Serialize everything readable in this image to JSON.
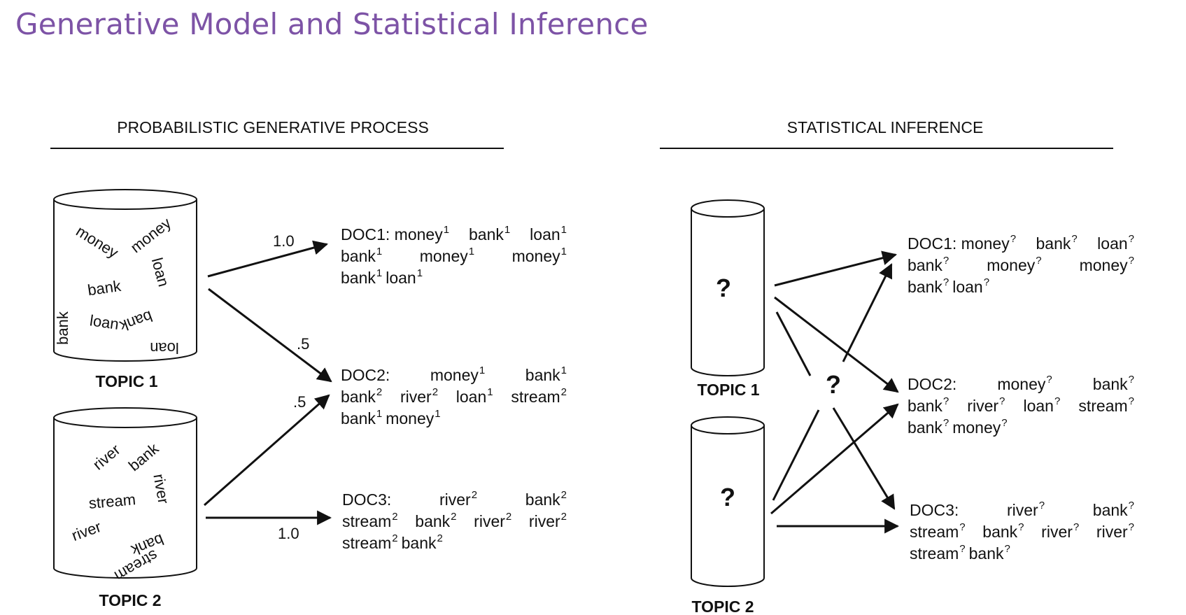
{
  "title": "Generative Model and Statistical Inference",
  "left_panel": {
    "header": "PROBABILISTIC GENERATIVE PROCESS",
    "topic1": {
      "label": "TOPIC 1",
      "words": [
        "money",
        "money",
        "loan",
        "bank",
        "bank",
        "loan",
        "bank",
        "loan"
      ]
    },
    "topic2": {
      "label": "TOPIC 2",
      "words": [
        "river",
        "bank",
        "river",
        "stream",
        "river",
        "bank",
        "stream"
      ]
    },
    "weights": {
      "topic1_doc1": "1.0",
      "topic1_doc2": ".5",
      "topic2_doc2": ".5",
      "topic2_doc3": "1.0"
    },
    "docs": {
      "doc1": {
        "line1": [
          [
            "DOC1: money",
            "1"
          ],
          [
            " bank",
            "1"
          ],
          [
            " loan",
            "1"
          ]
        ],
        "line2": [
          [
            "bank",
            "1"
          ],
          [
            "money",
            "1"
          ],
          [
            "money",
            "1"
          ]
        ],
        "line3": [
          [
            "bank",
            "1"
          ],
          [
            " loan",
            "1"
          ]
        ]
      },
      "doc2": {
        "line1": [
          [
            "DOC2:",
            ""
          ],
          [
            "money",
            "1"
          ],
          [
            "bank",
            "1"
          ]
        ],
        "line2": [
          [
            "bank",
            "2"
          ],
          [
            "river",
            "2"
          ],
          [
            "loan",
            "1"
          ],
          [
            "stream",
            "2"
          ]
        ],
        "line3": [
          [
            "bank",
            "1"
          ],
          [
            " money",
            "1"
          ]
        ]
      },
      "doc3": {
        "line1": [
          [
            "DOC3:",
            ""
          ],
          [
            "river",
            "2"
          ],
          [
            "bank",
            "2"
          ]
        ],
        "line2": [
          [
            "stream",
            "2"
          ],
          [
            "bank",
            "2"
          ],
          [
            "river",
            "2"
          ],
          [
            "river",
            "2"
          ]
        ],
        "line3": [
          [
            "stream",
            "2"
          ],
          [
            " bank",
            "2"
          ]
        ]
      }
    }
  },
  "right_panel": {
    "header": "STATISTICAL INFERENCE",
    "topic1": {
      "label": "TOPIC 1",
      "mark": "?"
    },
    "topic2": {
      "label": "TOPIC 2",
      "mark": "?"
    },
    "center_mark": "?",
    "docs": {
      "doc1": {
        "line1": [
          [
            "DOC1: money",
            "?"
          ],
          [
            " bank",
            "?"
          ],
          [
            " loan",
            "?"
          ]
        ],
        "line2": [
          [
            "bank",
            "?"
          ],
          [
            "money",
            "?"
          ],
          [
            "money",
            "?"
          ]
        ],
        "line3": [
          [
            "bank",
            "?"
          ],
          [
            " loan",
            "?"
          ]
        ]
      },
      "doc2": {
        "line1": [
          [
            "DOC2:",
            ""
          ],
          [
            "money",
            "?"
          ],
          [
            "bank",
            "?"
          ]
        ],
        "line2": [
          [
            "bank",
            "?"
          ],
          [
            "river",
            "?"
          ],
          [
            "loan",
            "?"
          ],
          [
            "stream",
            "?"
          ]
        ],
        "line3": [
          [
            "bank",
            "?"
          ],
          [
            " money",
            "?"
          ]
        ]
      },
      "doc3": {
        "line1": [
          [
            "DOC3:",
            ""
          ],
          [
            "river",
            "?"
          ],
          [
            "bank",
            "?"
          ]
        ],
        "line2": [
          [
            "stream",
            "?"
          ],
          [
            "bank",
            "?"
          ],
          [
            "river",
            "?"
          ],
          [
            "river",
            "?"
          ]
        ],
        "line3": [
          [
            "stream",
            "?"
          ],
          [
            " bank",
            "?"
          ]
        ]
      }
    }
  }
}
